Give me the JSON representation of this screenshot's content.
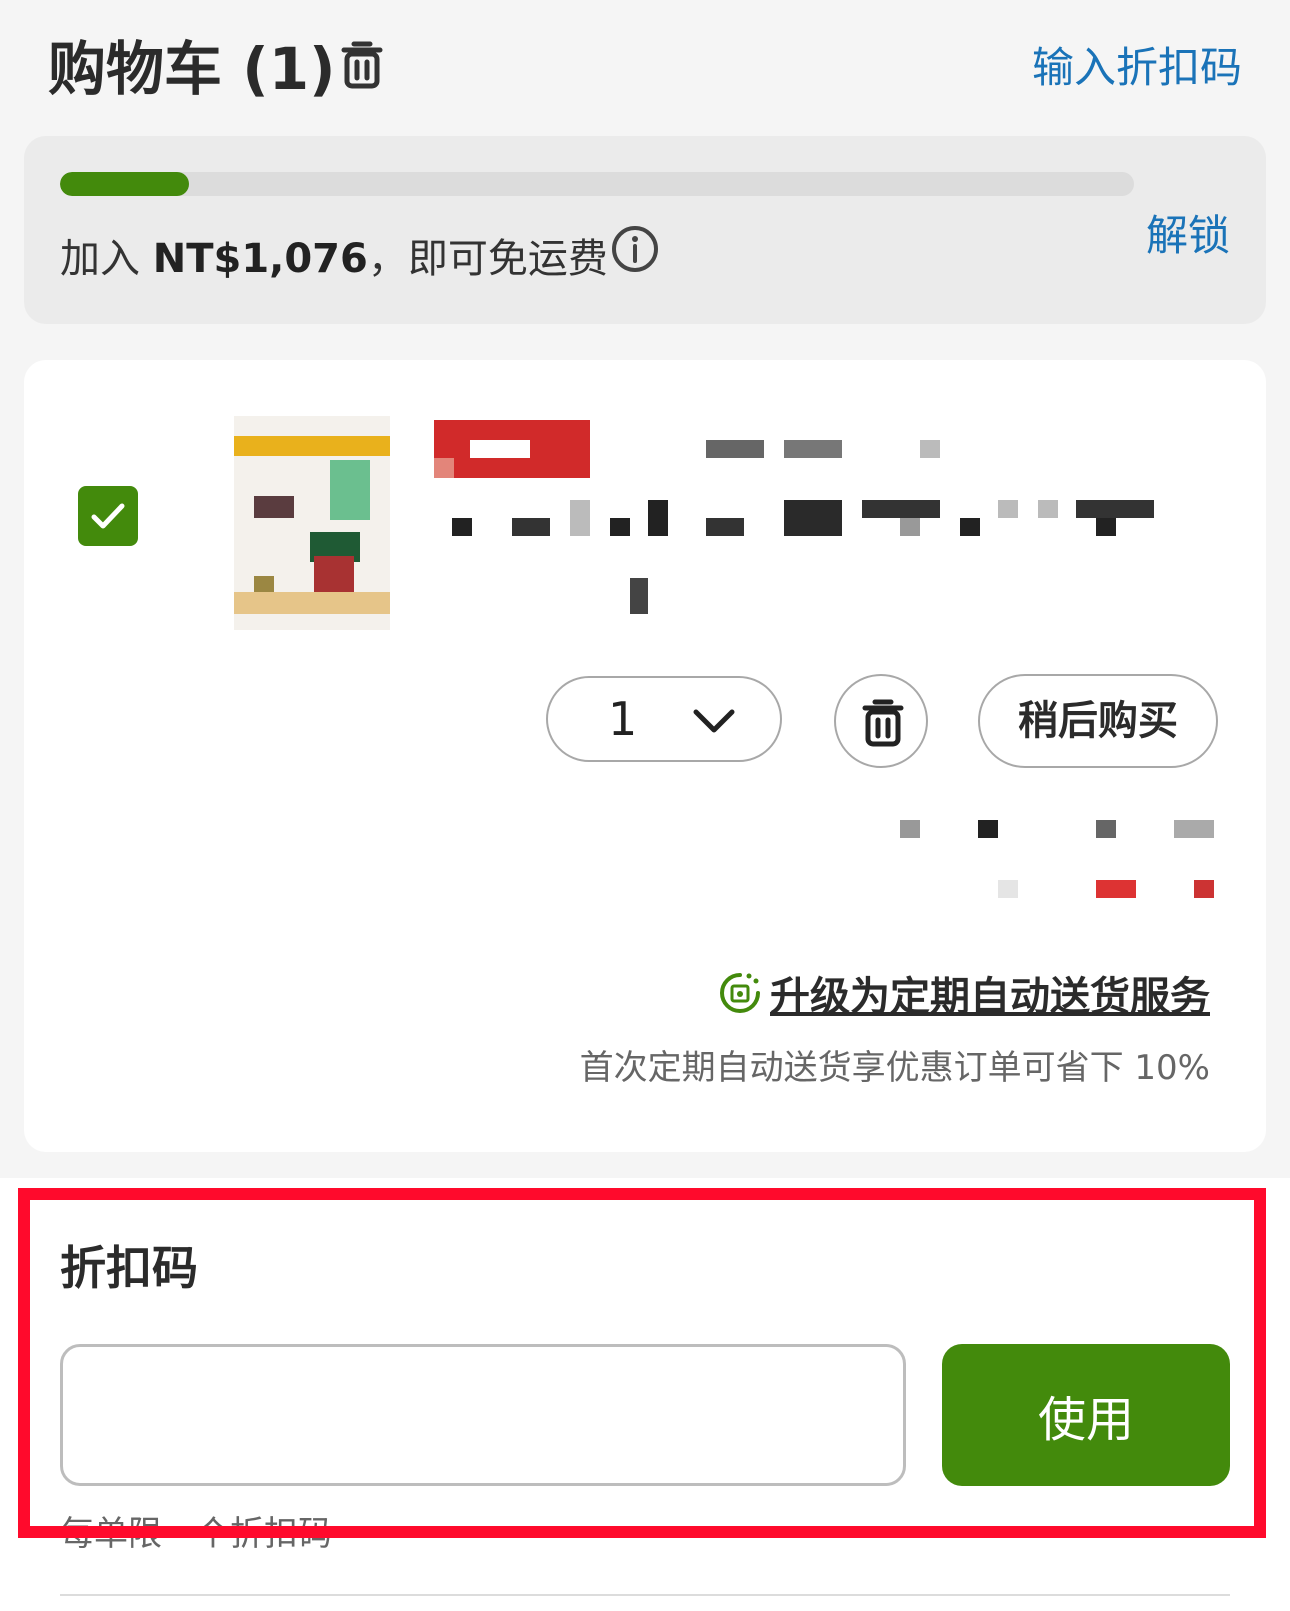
{
  "header": {
    "title": "购物车 (1)",
    "coupon_link": "输入折扣码"
  },
  "shipping": {
    "progress": 0.12,
    "text_prefix": "加入 ",
    "amount": "NT$1,076",
    "text_suffix": "，即可免运费",
    "unlock_label": "解锁"
  },
  "item": {
    "selected": true,
    "quantity": "1",
    "save_for_later_label": "稍后购买",
    "subscribe_label": "升级为定期自动送货服务",
    "subscribe_note": "首次定期自动送货享优惠订单可省下 10%"
  },
  "coupon": {
    "heading": "折扣码",
    "input_value": "",
    "input_placeholder": "",
    "apply_label": "使用",
    "hint": "每单限一个折扣码"
  },
  "colors": {
    "accent_green": "#438a0c",
    "link_blue": "#1a73b8",
    "highlight_red": "#ff0a2c"
  },
  "icons": [
    "trash-icon",
    "info-icon",
    "check-icon",
    "chevron-down-icon",
    "subscribe-icon"
  ]
}
